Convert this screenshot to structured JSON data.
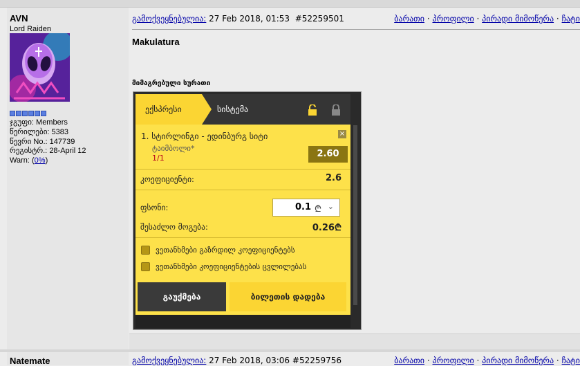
{
  "post1": {
    "username": "AVN",
    "rank": "Lord Raiden",
    "stats": {
      "group_label": "ჯგუფი:",
      "group_value": "Members",
      "posts_label": "წერილები:",
      "posts_value": "5383",
      "member_no_label": "წევრი No.:",
      "member_no_value": "147739",
      "reg_label": "რეგისტრ.:",
      "reg_value": "28-April 12",
      "warn_label": "Warn: (",
      "warn_value": "0%",
      "warn_suffix": ")"
    },
    "header": {
      "posted_label": "გამოქვეყნებულია:",
      "date": "27 Feb 2018, 01:53",
      "post_id": "#52259501"
    },
    "links": {
      "report": "ბარათი",
      "profile": "პროფილი",
      "pm": "პირადი მიმოწერა",
      "chat": "ჩატი",
      "sep": "·"
    },
    "title": "Makulatura",
    "attachment_label": "მიმაგრებული სურათი",
    "betslip": {
      "tab_express": "ექსპრესი",
      "tab_system": "სისტემა",
      "selection_name": "1. სტირლინგი - ედინბურგ სიტი",
      "selection_type": "ტაიმბოლი*",
      "selection_count": "1/1",
      "odds": "2.60",
      "close": "×",
      "coef_label": "კოეფიციენტი:",
      "coef_value": "2.6",
      "stake_label": "ფსონი:",
      "stake_value": "0.1",
      "currency": "₾",
      "chevron": "⌄",
      "win_label": "შესაძლო მოგება:",
      "win_value": "0.26₾",
      "option1": "ვეთანხმები გაზრდილ კოეფიციენტებს",
      "option2": "ვეთანხმები კოეფიციენტების ცვლილებას",
      "btn_cancel": "გაუქმება",
      "btn_place": "ბილეთის დადება"
    }
  },
  "post2": {
    "username": "Natemate",
    "header": {
      "posted_label": "გამოქვეყნებულია:",
      "date": "27 Feb 2018, 03:06",
      "post_id": "#52259756"
    },
    "links": {
      "report": "ბარათი",
      "profile": "პროფილი",
      "pm": "პირადი მიმოწერა",
      "chat": "ჩატი",
      "sep": "·"
    }
  },
  "colors": {
    "accent_yellow": "#fbd533",
    "link_blue": "#0000a8",
    "dark_button": "#3a3a3a",
    "odds_box": "#8a7512"
  }
}
